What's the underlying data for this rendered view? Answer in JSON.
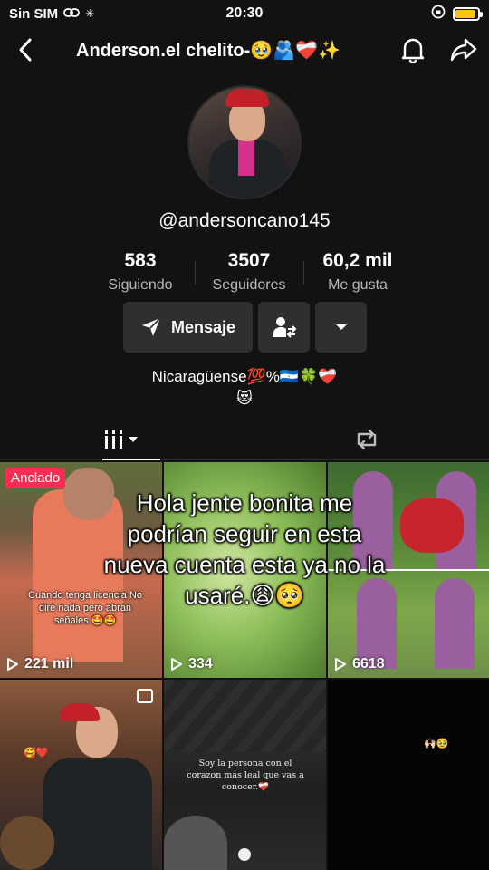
{
  "status_bar": {
    "carrier": "Sin SIM",
    "time": "20:30",
    "battery_level": 0.9
  },
  "header": {
    "title": "Anderson.el chelito-🥹🫂❤️‍🩹✨"
  },
  "profile": {
    "username": "@andersoncano145",
    "stats": [
      {
        "value": "583",
        "label": "Siguiendo"
      },
      {
        "value": "3507",
        "label": "Seguidores"
      },
      {
        "value": "60,2 mil",
        "label": "Me gusta"
      }
    ],
    "message_button": "Mensaje",
    "bio_line1": "Nicaragüense💯%🇳🇮🍀❤️‍🩹",
    "bio_line2": "😻"
  },
  "videos": [
    {
      "badge": "Anclado",
      "caption": "Cuando tenga licencia No diré nada pero abran señales.🤩🤩",
      "views": "221 mil"
    },
    {
      "views": "334"
    },
    {
      "views": "6618"
    },
    {
      "caption": "🥰❤️"
    },
    {
      "caption": "Soy la persona con  el corazon más leal que vas a conocer.❤️‍🩹"
    },
    {
      "caption": "🙌🏻🥹"
    }
  ],
  "overlay_text": {
    "line1": "Hola jente bonita me",
    "line2": "podrían seguir en esta",
    "line3": "nueva cuenta esta  ya no la",
    "line4": "usaré.😩🥺"
  },
  "colors": {
    "accent": "#fe2c55",
    "background": "#121212",
    "button": "#2f2f2f"
  }
}
